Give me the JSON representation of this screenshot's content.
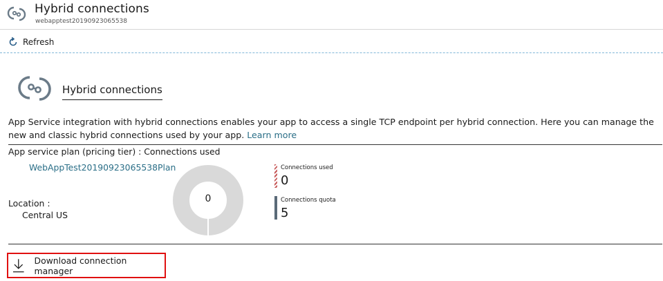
{
  "header": {
    "title": "Hybrid connections",
    "subtitle": "webapptest20190923065538"
  },
  "toolbar": {
    "refresh_label": "Refresh"
  },
  "section": {
    "title": "Hybrid connections",
    "description": "App Service integration with hybrid connections enables your app to access a single TCP endpoint per hybrid connection. Here you can manage the new and classic hybrid connections used by your app.",
    "learn_more": "Learn more"
  },
  "plan": {
    "label": "App service plan (pricing tier) : Connections used",
    "name": "WebAppTest20190923065538Plan"
  },
  "location": {
    "label": "Location :",
    "value": "Central US"
  },
  "usage": {
    "donut_value": "0",
    "used_label": "Connections used",
    "used_value": "0",
    "quota_label": "Connections quota",
    "quota_value": "5",
    "used_fraction": 0,
    "colors": {
      "donut_track": "#d9d9d9",
      "used": "#c75a5a",
      "quota": "#5a6a78"
    }
  },
  "download": {
    "label": "Download connection manager"
  },
  "icons": {
    "header": "hybrid-connections-icon",
    "refresh": "refresh-icon",
    "download": "download-icon"
  },
  "colors": {
    "link": "#2a6e87",
    "highlight_border": "#e01010"
  }
}
